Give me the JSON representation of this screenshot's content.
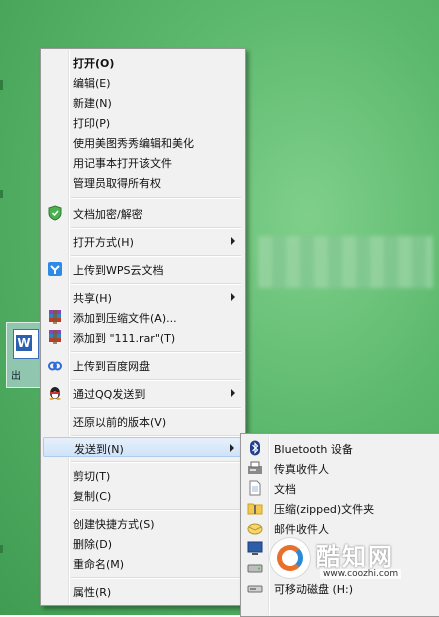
{
  "context_menu": {
    "items": [
      {
        "label": "打开(O)"
      },
      {
        "label": "编辑(E)"
      },
      {
        "label": "新建(N)"
      },
      {
        "label": "打印(P)"
      },
      {
        "label": "使用美图秀秀编辑和美化"
      },
      {
        "label": "用记事本打开该文件"
      },
      {
        "label": "管理员取得所有权"
      },
      {
        "label": "文档加密/解密"
      },
      {
        "label": "打开方式(H)"
      },
      {
        "label": "上传到WPS云文档"
      },
      {
        "label": "共享(H)"
      },
      {
        "label": "添加到压缩文件(A)..."
      },
      {
        "label": "添加到 \"111.rar\"(T)"
      },
      {
        "label": "上传到百度网盘"
      },
      {
        "label": "通过QQ发送到"
      },
      {
        "label": "还原以前的版本(V)"
      },
      {
        "label": "发送到(N)"
      },
      {
        "label": "剪切(T)"
      },
      {
        "label": "复制(C)"
      },
      {
        "label": "创建快捷方式(S)"
      },
      {
        "label": "删除(D)"
      },
      {
        "label": "重命名(M)"
      },
      {
        "label": "属性(R)"
      }
    ]
  },
  "send_to_submenu": {
    "items": [
      {
        "label": "Bluetooth 设备",
        "icon": "bluetooth-icon"
      },
      {
        "label": "传真收件人",
        "icon": "fax-icon"
      },
      {
        "label": "文档",
        "icon": "documents-icon"
      },
      {
        "label": "压缩(zipped)文件夹",
        "icon": "zip-folder-icon"
      },
      {
        "label": "邮件收件人",
        "icon": "mail-icon"
      },
      {
        "label": "桌",
        "icon": "desktop-icon"
      },
      {
        "label": "(",
        "icon": "drive-icon"
      },
      {
        "label": "可移动磁盘 (H:)",
        "icon": "removable-disk-icon"
      }
    ]
  },
  "desktop_file": {
    "badge": "W",
    "name_fragment": "出"
  },
  "watermark": {
    "title": "酷知网",
    "url": "www.coozhi.com"
  },
  "colors": {
    "desktop": "#5bb86c",
    "menu_bg": "#f1f1f1",
    "highlight": "#cfe3f8"
  }
}
